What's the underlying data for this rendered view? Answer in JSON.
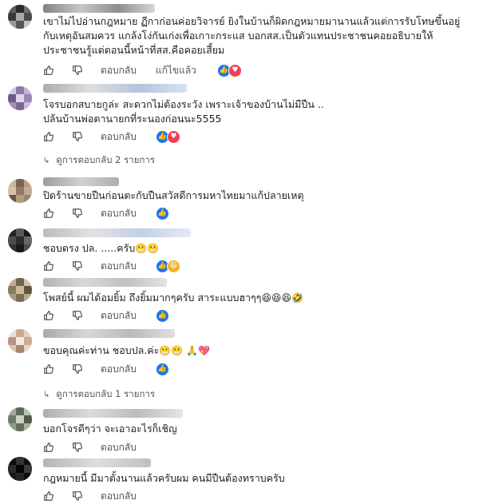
{
  "actions": {
    "reply_label": "ตอบกลับ",
    "edited_label": "แก้ไขแล้ว"
  },
  "comments": [
    {
      "lines": [
        "เขาไม่ไปอ่านกฎหมาย ฏีกาก่อนค่อยวิจารย์ ยิงในบ้านก็ผิดกฎหมายมานานแล้วแต่การรับโทษขึ้นอยู่",
        "กับเหตุอันสมควร แกล้งโง่กันเก่งเพื่อเกาะกระแส บอกสส.เป็นตัวแทนประชาชนคอยอธิบายให้",
        "ประชาชนรู้แต่ตอนนี้หน้าที่สส.คือคอยเสี้ยม"
      ],
      "edited": true,
      "reactions": [
        "like",
        "love"
      ]
    },
    {
      "lines": [
        "โจรบอกสบายกูล่ะ สะดวกไม่ต้องระวัง เพราะเจ้าของบ้านไม่มีปืน ..",
        "ปล้นบ้านพ่อตานายกที่ระนองก่อนนะ5555"
      ],
      "reactions": [
        "like",
        "love"
      ],
      "view_replies": "ดูการตอบกลับ 2 รายการ"
    },
    {
      "lines": [
        "ปิดร้านขายปืนก่อนตะกับปืนสวัสดีการมหาไทยมาแก้ปลายเหตุ"
      ],
      "reactions": [
        "like"
      ]
    },
    {
      "lines": [
        "ชอบตรง ปล. .....ครับ"
      ],
      "emoji": "😬😬",
      "reactions": [
        "like",
        "haha"
      ]
    },
    {
      "lines": [
        "โพสย์นี้ ผมได้อมยิ้ม ถึงยิ้มมากๆครับ สาระแบบฮาๆๆ"
      ],
      "emoji": "😆😆😆🤣",
      "reactions": [
        "like"
      ]
    },
    {
      "lines": [
        "ขอบคุณค่ะท่าน ชอบปล.ค่ะ"
      ],
      "emoji": "😬😬 🙏💖",
      "reactions": [
        "like"
      ],
      "view_replies": "ดูการตอบกลับ 1 รายการ"
    },
    {
      "lines": [
        "บอกโจรดีๆว่า จะเอาอะไรก็เชิญ"
      ],
      "reactions": []
    },
    {
      "lines": [
        "กฎหมายนี้ มีมาตั้งนานแล้วครับผม คนมีปืนต้องทราบครับ"
      ],
      "reactions": []
    }
  ]
}
